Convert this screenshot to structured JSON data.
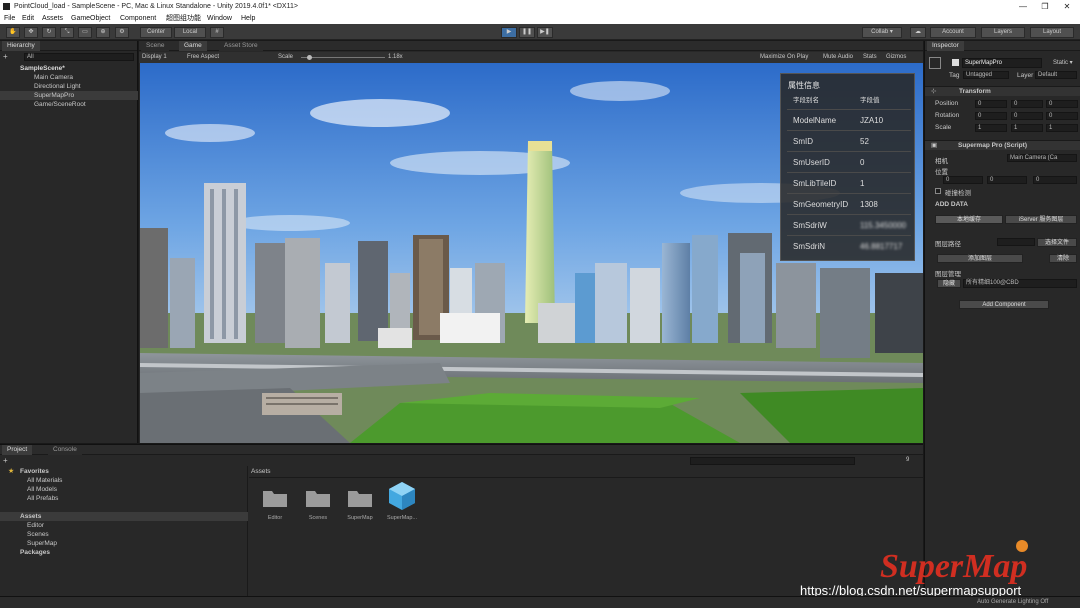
{
  "window": {
    "title": "PointCloud_load - SampleScene - PC, Mac & Linux Standalone - Unity 2019.4.0f1* <DX11>",
    "controls": [
      "—",
      "❐",
      "✕"
    ]
  },
  "menu": [
    "File",
    "Edit",
    "Assets",
    "GameObject",
    "Component",
    "超图组功能",
    "Window",
    "Help"
  ],
  "toolbar": {
    "pivot": "Center",
    "space": "Local",
    "collab": "Collab ▾",
    "account": "Account",
    "layers": "Layers",
    "layout": "Layout"
  },
  "hierarchy": {
    "tab": "Hierarchy",
    "search": "All",
    "items": [
      {
        "label": "SampleScene*"
      },
      {
        "label": "Main Camera"
      },
      {
        "label": "Directional Light"
      },
      {
        "label": "SuperMapPro"
      },
      {
        "label": "Game/SceneRoot"
      }
    ]
  },
  "game_view": {
    "tabs": [
      "Scene",
      "Game",
      "Asset Store"
    ],
    "display": "Display 1",
    "aspect": "Free Aspect",
    "scale_label": "Scale",
    "scale_value": "1.18x",
    "options": [
      "Maximize On Play",
      "Mute Audio",
      "Stats",
      "Gizmos"
    ]
  },
  "attr_panel": {
    "title": "属性信息",
    "col_name": "字段别名",
    "col_value": "字段值",
    "rows": [
      {
        "k": "ModelName",
        "v": "JZA10"
      },
      {
        "k": "SmID",
        "v": "52"
      },
      {
        "k": "SmUserID",
        "v": "0"
      },
      {
        "k": "SmLibTileID",
        "v": "1"
      },
      {
        "k": "SmGeometryID",
        "v": "1308"
      },
      {
        "k": "SmSdriW",
        "v": "115.3450000"
      },
      {
        "k": "SmSdriN",
        "v": "46.8817717"
      }
    ]
  },
  "inspector": {
    "tab": "Inspector",
    "object_name": "SuperMapPro",
    "static": "Static ▾",
    "tag_label": "Tag",
    "tag_value": "Untagged",
    "layer_label": "Layer",
    "layer_value": "Default",
    "transform": {
      "title": "Transform",
      "position": {
        "label": "Position",
        "x": "0",
        "y": "0",
        "z": "0"
      },
      "rotation": {
        "label": "Rotation",
        "x": "0",
        "y": "0",
        "z": "0"
      },
      "scale": {
        "label": "Scale",
        "x": "1",
        "y": "1",
        "z": "1"
      }
    },
    "script": {
      "title": "Supermap Pro (Script)",
      "camera_label": "相机",
      "camera_value": "Main Camera (Ca",
      "position_label": "位置",
      "pos": {
        "x": "0",
        "y": "0",
        "z": "0"
      },
      "collision_label": "碰撞检测",
      "add_data": "ADD DATA",
      "local_cache": "本地缓存",
      "iserver": "iServer 服务图层",
      "layer_path": "图层路径",
      "choose_file": "选择文件",
      "add_layer": "添加图层",
      "clear": "清除",
      "layer_manage": "图层管理",
      "hide": "隐藏",
      "layer_name": "所有精细100@CBD",
      "add_component": "Add Component"
    }
  },
  "project": {
    "tabs": [
      "Project",
      "Console"
    ],
    "favorites": "Favorites",
    "fav_items": [
      "All Materials",
      "All Models",
      "All Prefabs"
    ],
    "assets": "Assets",
    "asset_items": [
      "Editor",
      "Scenes",
      "SuperMap"
    ],
    "packages": "Packages",
    "breadcrumb": "Assets",
    "files": [
      {
        "name": "Editor",
        "kind": "folder-icon"
      },
      {
        "name": "Scenes",
        "kind": "folder-icon"
      },
      {
        "name": "SuperMap",
        "kind": "folder-icon"
      },
      {
        "name": "SuperMap...",
        "kind": "cube-icon"
      }
    ],
    "count": "9"
  },
  "status": {
    "right": "Auto Generate Lighting Off"
  },
  "watermark": {
    "logo": "SuperMap",
    "url": "https://blog.csdn.net/supermapsupport"
  }
}
